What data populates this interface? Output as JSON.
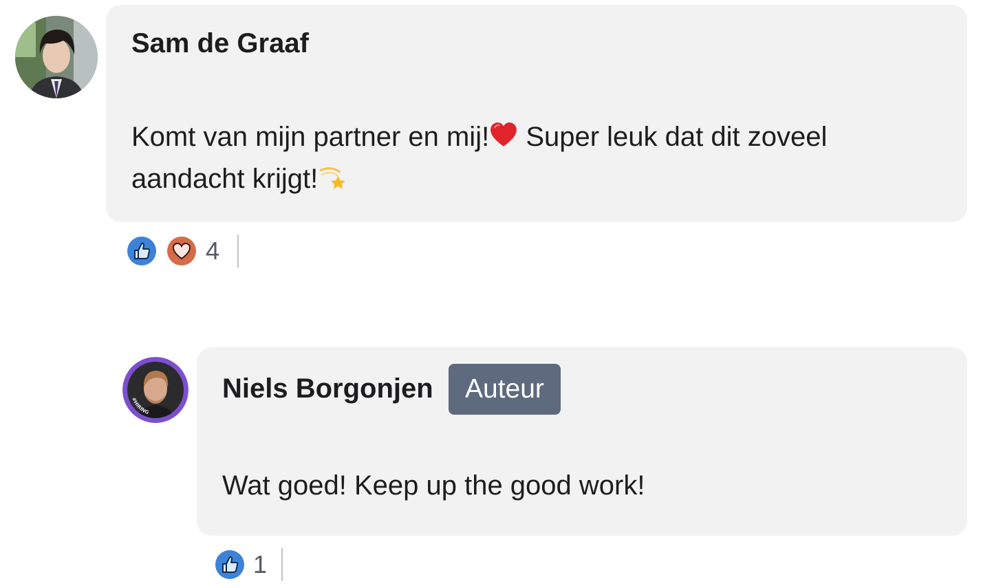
{
  "comments": [
    {
      "author": "Sam de Graaf",
      "text_part1": "Komt van mijn partner en mij!",
      "emoji1": "red-heart",
      "text_part2": " Super leuk dat dit zoveel aandacht krijgt!",
      "emoji2": "dizzy-star",
      "reactions": {
        "types": [
          "like",
          "love"
        ],
        "count": "4"
      }
    },
    {
      "author": "Niels Borgonjen",
      "badge": "Auteur",
      "text": "Wat goed! Keep up the good work!",
      "avatar_ring_text": "#HIRING",
      "reactions": {
        "types": [
          "like"
        ],
        "count": "1"
      }
    }
  ],
  "colors": {
    "bubble": "#f2f2f2",
    "badge": "#5e6a7d",
    "like": "#3c82d8",
    "love": "#d56b49",
    "hiring_ring": "#7d4fd0"
  }
}
